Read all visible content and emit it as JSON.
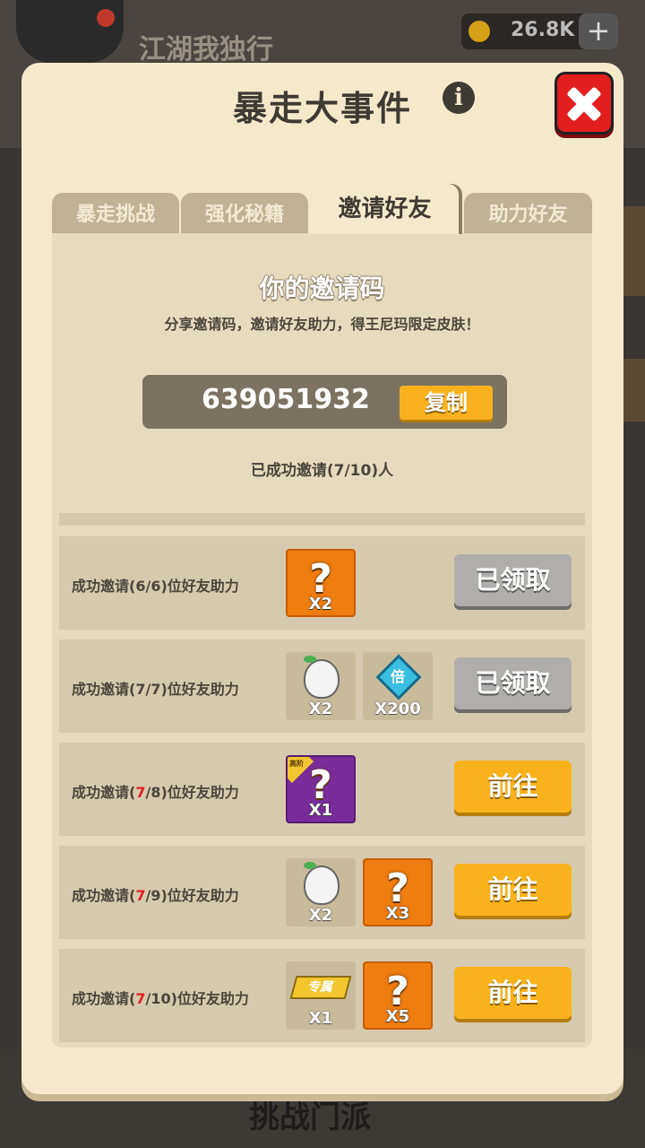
{
  "background": {
    "title": "江湖我独行",
    "coins": "26.8K",
    "bottom_label": "挑战门派"
  },
  "modal": {
    "title": "暴走大事件",
    "info_icon": "info-icon",
    "close_icon": "close-icon",
    "tabs": [
      {
        "label": "暴走挑战"
      },
      {
        "label": "强化秘籍"
      },
      {
        "label": "邀请好友"
      },
      {
        "label": "助力好友"
      }
    ],
    "active_tab": "邀请好友",
    "invite": {
      "heading": "你的邀请码",
      "subheading": "分享邀请码，邀请好友助力，得王尼玛限定皮肤！",
      "code": "639051932",
      "copy_label": "复制",
      "invited_status": "已成功邀请(7/10)人"
    },
    "rewards": [
      {
        "label_prefix": "成功邀请(",
        "count": "6",
        "label_total": "/6)位好友助力",
        "items": [
          {
            "type": "shirt",
            "icon": "mystery-shirt-icon",
            "count": "X2"
          }
        ],
        "button": "已领取",
        "state": "claimed"
      },
      {
        "label_prefix": "成功邀请(",
        "count": "7",
        "label_total": "/7)位好友助力",
        "items": [
          {
            "type": "blob",
            "icon": "wang-nima-face-icon",
            "count": "X2"
          },
          {
            "type": "gem",
            "icon": "multiplier-gem-icon",
            "glyph": "倍",
            "count": "X200"
          }
        ],
        "button": "已领取",
        "state": "claimed"
      },
      {
        "label_prefix": "成功邀请(",
        "count": "7",
        "label_total": "/8)位好友助力",
        "items": [
          {
            "type": "purple",
            "icon": "mystery-purple-icon",
            "corner": "高阶",
            "count": "X1"
          }
        ],
        "button": "前往",
        "state": "go"
      },
      {
        "label_prefix": "成功邀请(",
        "count": "7",
        "label_total": "/9)位好友助力",
        "items": [
          {
            "type": "blob",
            "icon": "wang-nima-face-icon",
            "count": "X2"
          },
          {
            "type": "shirt",
            "icon": "mystery-shirt-icon",
            "count": "X3"
          }
        ],
        "button": "前往",
        "state": "go"
      },
      {
        "label_prefix": "成功邀请(",
        "count": "7",
        "label_total": "/10)位好友助力",
        "items": [
          {
            "type": "badge",
            "icon": "exclusive-badge-icon",
            "glyph": "专属",
            "count": "X1"
          },
          {
            "type": "shirt",
            "icon": "mystery-shirt-icon",
            "count": "X5"
          }
        ],
        "button": "前往",
        "state": "go"
      }
    ],
    "colors": {
      "modal_bg": "#f5e9cc",
      "go_button": "#f7b21d",
      "claimed_button": "#b0aeac",
      "close_button": "#e31e1e",
      "highlight_count": "#e02222"
    }
  }
}
